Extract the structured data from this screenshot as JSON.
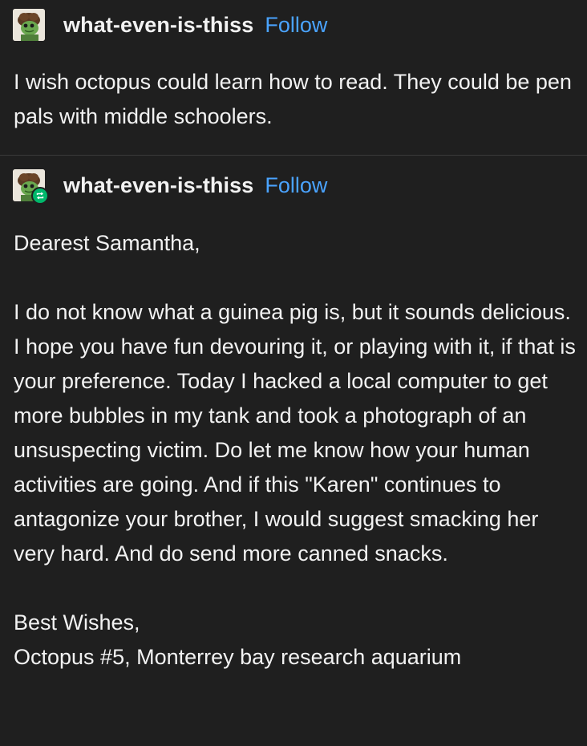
{
  "posts": [
    {
      "username": "what-even-is-thiss",
      "follow_label": "Follow",
      "reblogged": false,
      "body": [
        "I wish octopus could learn how to read. They could be pen pals with middle schoolers."
      ]
    },
    {
      "username": "what-even-is-thiss",
      "follow_label": "Follow",
      "reblogged": true,
      "body": [
        "Dearest Samantha,",
        "I do not know what a guinea pig is, but it sounds delicious. I hope you have fun devouring it, or playing with it, if that is your preference. Today I hacked a local computer to get more bubbles in my tank and took a photograph of an unsuspecting victim. Do let me know how your human activities are going. And if this \"Karen\" continues to antagonize your brother, I would suggest smacking her very hard. And do send more canned snacks.",
        "Best Wishes,"
      ],
      "signature": "Octopus #5, Monterrey bay research aquarium"
    }
  ],
  "colors": {
    "background": "#1f1f1f",
    "text": "#f2f2f2",
    "follow_link": "#4aa3ff",
    "reblog_badge": "#00b86b",
    "divider": "#3a3a3a"
  },
  "icons": {
    "avatar": "frog-avatar-icon",
    "reblog": "reblog-icon"
  }
}
